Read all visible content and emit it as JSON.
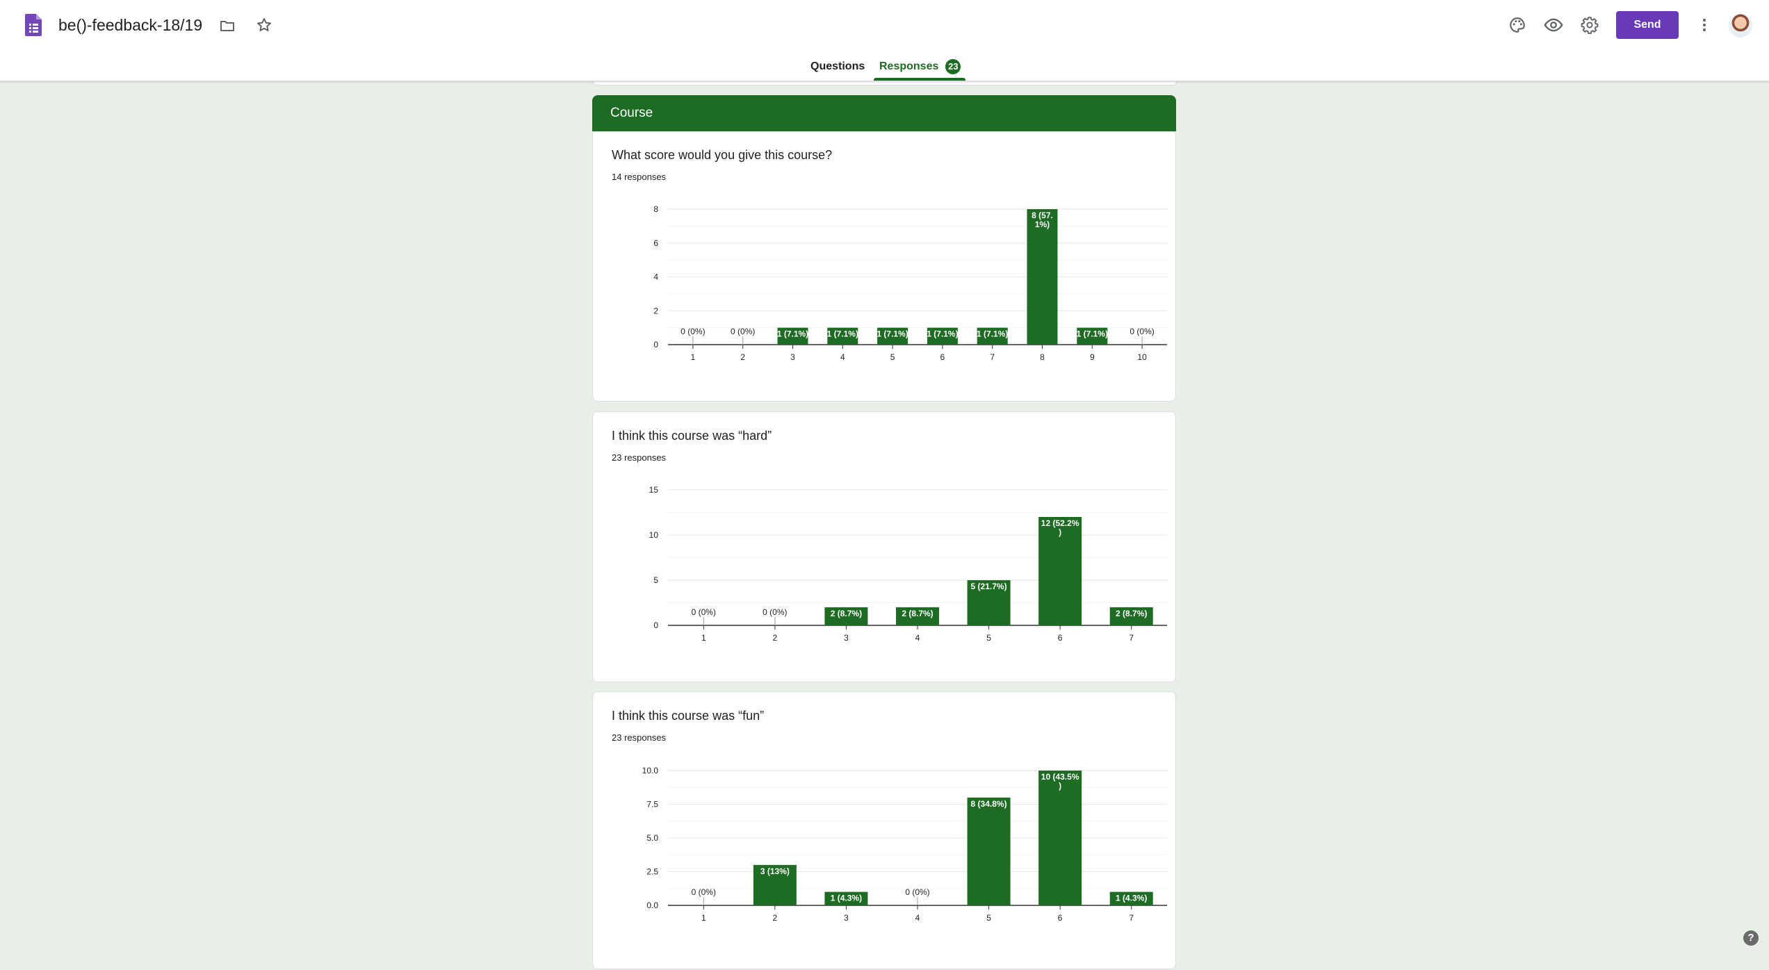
{
  "header": {
    "title": "be()-feedback-18/19",
    "send_label": "Send",
    "icons": [
      "forms-icon",
      "folder-icon",
      "star-icon",
      "palette-icon",
      "preview-eye-icon",
      "settings-gear-icon",
      "more-vert-icon",
      "avatar"
    ]
  },
  "tabs": [
    {
      "label": "Questions"
    },
    {
      "label": "Responses",
      "badge": "23"
    }
  ],
  "section": {
    "title": "Course"
  },
  "colors": {
    "accent": "#1e6b24",
    "brand": "#673ab7",
    "background": "#e8efe7"
  },
  "cards": [
    {
      "question": "What score would you give this course?",
      "responses": "14 responses"
    },
    {
      "question": "I think this course was “hard”",
      "responses": "23 responses"
    },
    {
      "question": "I think this course was “fun”",
      "responses": "23 responses"
    }
  ],
  "chart_data": [
    {
      "type": "bar",
      "categories": [
        "1",
        "2",
        "3",
        "4",
        "5",
        "6",
        "7",
        "8",
        "9",
        "10"
      ],
      "values": [
        0,
        0,
        1,
        1,
        1,
        1,
        1,
        8,
        1,
        0
      ],
      "labels": [
        [
          "0 (0%)"
        ],
        [
          "0 (0%)"
        ],
        [
          "1 (7.1%)"
        ],
        [
          "1 (7.1%)"
        ],
        [
          "1 (7.1%)"
        ],
        [
          "1 (7.1%)"
        ],
        [
          "1 (7.1%)"
        ],
        [
          "8 (57.",
          "1%)"
        ],
        [
          "1 (7.1%)"
        ],
        [
          "0 (0%)"
        ]
      ],
      "yticks": [
        "0",
        "2",
        "4",
        "6",
        "8"
      ],
      "ylim": [
        0,
        8
      ],
      "grid": true
    },
    {
      "type": "bar",
      "categories": [
        "1",
        "2",
        "3",
        "4",
        "5",
        "6",
        "7"
      ],
      "values": [
        0,
        0,
        2,
        2,
        5,
        12,
        2
      ],
      "labels": [
        [
          "0 (0%)"
        ],
        [
          "0 (0%)"
        ],
        [
          "2 (8.7%)"
        ],
        [
          "2 (8.7%)"
        ],
        [
          "5 (21.7%)"
        ],
        [
          "12 (52.2%",
          ")"
        ],
        [
          "2 (8.7%)"
        ]
      ],
      "yticks": [
        "0",
        "5",
        "10",
        "15"
      ],
      "ylim": [
        0,
        15
      ],
      "grid": true
    },
    {
      "type": "bar",
      "categories": [
        "1",
        "2",
        "3",
        "4",
        "5",
        "6",
        "7"
      ],
      "values": [
        0,
        3,
        1,
        0,
        8,
        10,
        1
      ],
      "labels": [
        [
          "0 (0%)"
        ],
        [
          "3 (13%)"
        ],
        [
          "1 (4.3%)"
        ],
        [
          "0 (0%)"
        ],
        [
          "8 (34.8%)"
        ],
        [
          "10 (43.5%",
          ")"
        ],
        [
          "1 (4.3%)"
        ]
      ],
      "yticks": [
        "0.0",
        "2.5",
        "5.0",
        "7.5",
        "10.0"
      ],
      "ylim": [
        0,
        10
      ],
      "grid": true
    }
  ],
  "help": "?"
}
